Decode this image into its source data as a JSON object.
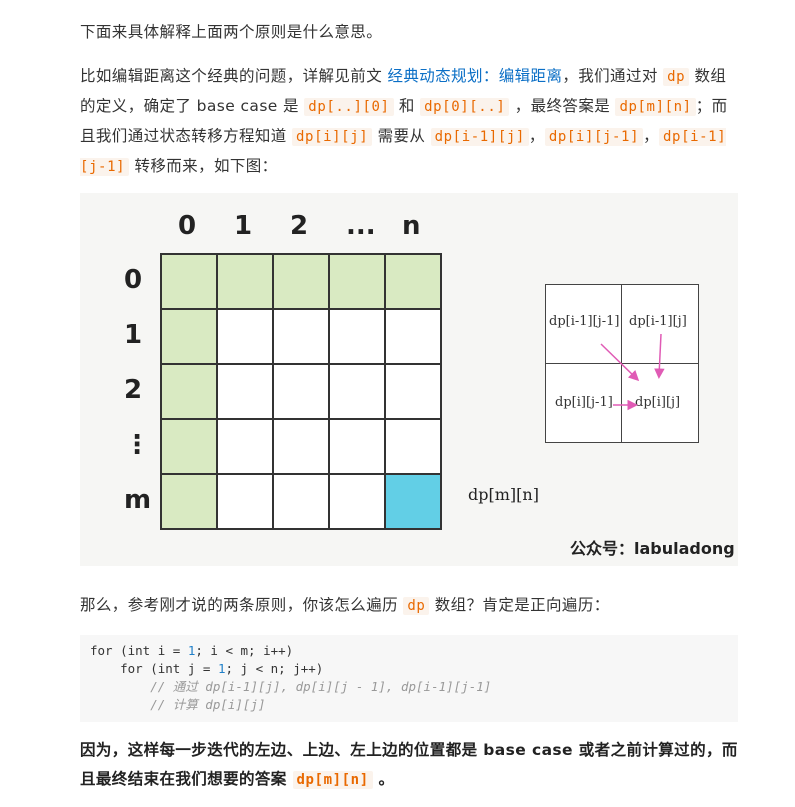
{
  "p1": "下面来具体解释上面两个原则是什么意思。",
  "p2": {
    "t1": "比如编辑距离这个经典的问题，详解见前文",
    "link": "经典动态规划：编辑距离",
    "t2": "，我们通过对",
    "c1": "dp",
    "t3": "数组的定义，确定了 base case 是",
    "c2": "dp[..][0]",
    "t4": "和",
    "c3": "dp[0][..]",
    "t5": "，最终答案是",
    "c4": "dp[m][n]",
    "t6": "；而且我们通过状态转移方程知道",
    "c5": "dp[i][j]",
    "t7": "需要从",
    "c6": "dp[i-1][j]",
    "t8": "，",
    "c7": "dp[i][j-1]",
    "t9": "，",
    "c8": "dp[i-1][j-1]",
    "t10": "转移而来，如下图："
  },
  "figure": {
    "col_labels": [
      "0",
      "1",
      "2",
      "...",
      "n"
    ],
    "row_labels": [
      "0",
      "1",
      "2",
      "⋮",
      "m"
    ],
    "result_label": "dp[m][n]",
    "watermark": "公众号：labuladong",
    "small_grid": {
      "top_left": "dp[i-1][j-1]",
      "top_right": "dp[i-1][j]",
      "bottom_left": "dp[i][j-1]",
      "bottom_right": "dp[i][j]"
    },
    "colors": {
      "green": "#d9eac2",
      "cyan": "#62cfe6",
      "arrow": "#e05bb5"
    }
  },
  "p3": {
    "t1": "那么，参考刚才说的两条原则，你该怎么遍历",
    "c1": "dp",
    "t2": "数组？肯定是正向遍历："
  },
  "code": {
    "line1_a": "for (int i = ",
    "line1_num": "1",
    "line1_b": "; i < m; i++)",
    "line2_a": "    for (int j = ",
    "line2_num": "1",
    "line2_b": "; j < n; j++)",
    "line3": "        // 通过 dp[i-1][j], dp[i][j - 1], dp[i-1][j-1]",
    "line4": "        // 计算 dp[i][j]"
  },
  "p4": {
    "t1": "因为，这样每一步迭代的左边、上边、左上边的位置都是 base case 或者之前计算过的，而且最终结束在我们想要的答案",
    "c1": "dp[m][n]",
    "t2": "。"
  }
}
